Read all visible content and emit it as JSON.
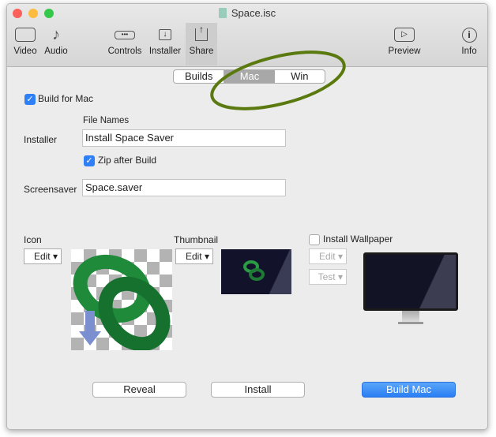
{
  "window": {
    "title": "Space.isc"
  },
  "toolbar": {
    "items": [
      {
        "label": "Video",
        "icon": "video-icon"
      },
      {
        "label": "Audio",
        "icon": "audio-icon"
      },
      {
        "label": "Controls",
        "icon": "controls-icon"
      },
      {
        "label": "Installer",
        "icon": "installer-icon"
      },
      {
        "label": "Share",
        "icon": "share-icon",
        "selected": true
      },
      {
        "label": "Preview",
        "icon": "preview-icon"
      },
      {
        "label": "Info",
        "icon": "info-icon"
      }
    ]
  },
  "segments": [
    {
      "label": "Builds"
    },
    {
      "label": "Mac",
      "selected": true
    },
    {
      "label": "Win"
    }
  ],
  "build_for_mac": {
    "label": "Build for Mac",
    "checked": true
  },
  "file_names_header": "File Names",
  "installer": {
    "label": "Installer",
    "value": "Install Space Saver"
  },
  "zip": {
    "label": "Zip after Build",
    "checked": true
  },
  "screensaver": {
    "label": "Screensaver",
    "value": "Space.saver"
  },
  "icon": {
    "label": "Icon",
    "edit": "Edit"
  },
  "thumbnail": {
    "label": "Thumbnail",
    "edit": "Edit"
  },
  "wallpaper": {
    "label": "Install Wallpaper",
    "checked": false,
    "edit": "Edit",
    "test": "Test"
  },
  "buttons": {
    "reveal": "Reveal",
    "install": "Install",
    "build": "Build Mac"
  },
  "colors": {
    "accent": "#2f7ff7",
    "annotation": "#5a7a10"
  }
}
